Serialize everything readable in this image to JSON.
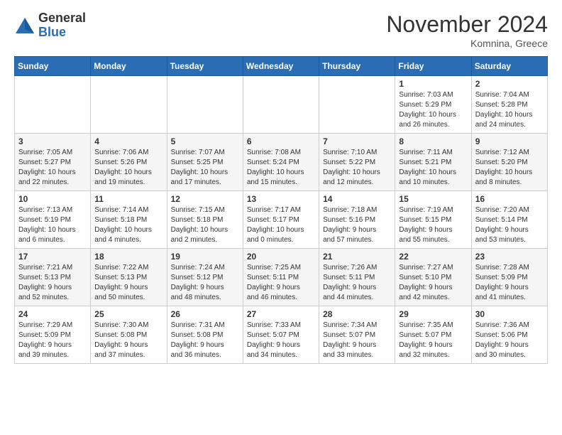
{
  "header": {
    "logo": {
      "general": "General",
      "blue": "Blue"
    },
    "month": "November 2024",
    "location": "Komnina, Greece"
  },
  "weekdays": [
    "Sunday",
    "Monday",
    "Tuesday",
    "Wednesday",
    "Thursday",
    "Friday",
    "Saturday"
  ],
  "weeks": [
    [
      {
        "day": "",
        "info": ""
      },
      {
        "day": "",
        "info": ""
      },
      {
        "day": "",
        "info": ""
      },
      {
        "day": "",
        "info": ""
      },
      {
        "day": "",
        "info": ""
      },
      {
        "day": "1",
        "info": "Sunrise: 7:03 AM\nSunset: 5:29 PM\nDaylight: 10 hours\nand 26 minutes."
      },
      {
        "day": "2",
        "info": "Sunrise: 7:04 AM\nSunset: 5:28 PM\nDaylight: 10 hours\nand 24 minutes."
      }
    ],
    [
      {
        "day": "3",
        "info": "Sunrise: 7:05 AM\nSunset: 5:27 PM\nDaylight: 10 hours\nand 22 minutes."
      },
      {
        "day": "4",
        "info": "Sunrise: 7:06 AM\nSunset: 5:26 PM\nDaylight: 10 hours\nand 19 minutes."
      },
      {
        "day": "5",
        "info": "Sunrise: 7:07 AM\nSunset: 5:25 PM\nDaylight: 10 hours\nand 17 minutes."
      },
      {
        "day": "6",
        "info": "Sunrise: 7:08 AM\nSunset: 5:24 PM\nDaylight: 10 hours\nand 15 minutes."
      },
      {
        "day": "7",
        "info": "Sunrise: 7:10 AM\nSunset: 5:22 PM\nDaylight: 10 hours\nand 12 minutes."
      },
      {
        "day": "8",
        "info": "Sunrise: 7:11 AM\nSunset: 5:21 PM\nDaylight: 10 hours\nand 10 minutes."
      },
      {
        "day": "9",
        "info": "Sunrise: 7:12 AM\nSunset: 5:20 PM\nDaylight: 10 hours\nand 8 minutes."
      }
    ],
    [
      {
        "day": "10",
        "info": "Sunrise: 7:13 AM\nSunset: 5:19 PM\nDaylight: 10 hours\nand 6 minutes."
      },
      {
        "day": "11",
        "info": "Sunrise: 7:14 AM\nSunset: 5:18 PM\nDaylight: 10 hours\nand 4 minutes."
      },
      {
        "day": "12",
        "info": "Sunrise: 7:15 AM\nSunset: 5:18 PM\nDaylight: 10 hours\nand 2 minutes."
      },
      {
        "day": "13",
        "info": "Sunrise: 7:17 AM\nSunset: 5:17 PM\nDaylight: 10 hours\nand 0 minutes."
      },
      {
        "day": "14",
        "info": "Sunrise: 7:18 AM\nSunset: 5:16 PM\nDaylight: 9 hours\nand 57 minutes."
      },
      {
        "day": "15",
        "info": "Sunrise: 7:19 AM\nSunset: 5:15 PM\nDaylight: 9 hours\nand 55 minutes."
      },
      {
        "day": "16",
        "info": "Sunrise: 7:20 AM\nSunset: 5:14 PM\nDaylight: 9 hours\nand 53 minutes."
      }
    ],
    [
      {
        "day": "17",
        "info": "Sunrise: 7:21 AM\nSunset: 5:13 PM\nDaylight: 9 hours\nand 52 minutes."
      },
      {
        "day": "18",
        "info": "Sunrise: 7:22 AM\nSunset: 5:13 PM\nDaylight: 9 hours\nand 50 minutes."
      },
      {
        "day": "19",
        "info": "Sunrise: 7:24 AM\nSunset: 5:12 PM\nDaylight: 9 hours\nand 48 minutes."
      },
      {
        "day": "20",
        "info": "Sunrise: 7:25 AM\nSunset: 5:11 PM\nDaylight: 9 hours\nand 46 minutes."
      },
      {
        "day": "21",
        "info": "Sunrise: 7:26 AM\nSunset: 5:11 PM\nDaylight: 9 hours\nand 44 minutes."
      },
      {
        "day": "22",
        "info": "Sunrise: 7:27 AM\nSunset: 5:10 PM\nDaylight: 9 hours\nand 42 minutes."
      },
      {
        "day": "23",
        "info": "Sunrise: 7:28 AM\nSunset: 5:09 PM\nDaylight: 9 hours\nand 41 minutes."
      }
    ],
    [
      {
        "day": "24",
        "info": "Sunrise: 7:29 AM\nSunset: 5:09 PM\nDaylight: 9 hours\nand 39 minutes."
      },
      {
        "day": "25",
        "info": "Sunrise: 7:30 AM\nSunset: 5:08 PM\nDaylight: 9 hours\nand 37 minutes."
      },
      {
        "day": "26",
        "info": "Sunrise: 7:31 AM\nSunset: 5:08 PM\nDaylight: 9 hours\nand 36 minutes."
      },
      {
        "day": "27",
        "info": "Sunrise: 7:33 AM\nSunset: 5:07 PM\nDaylight: 9 hours\nand 34 minutes."
      },
      {
        "day": "28",
        "info": "Sunrise: 7:34 AM\nSunset: 5:07 PM\nDaylight: 9 hours\nand 33 minutes."
      },
      {
        "day": "29",
        "info": "Sunrise: 7:35 AM\nSunset: 5:07 PM\nDaylight: 9 hours\nand 32 minutes."
      },
      {
        "day": "30",
        "info": "Sunrise: 7:36 AM\nSunset: 5:06 PM\nDaylight: 9 hours\nand 30 minutes."
      }
    ]
  ]
}
